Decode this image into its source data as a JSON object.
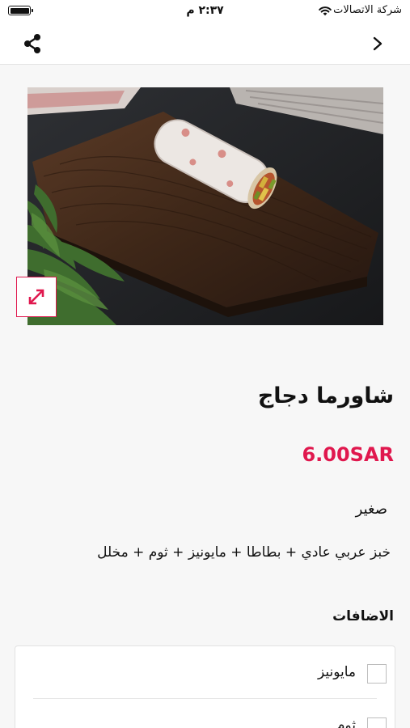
{
  "status_bar": {
    "carrier": "شركة الاتصالات",
    "time": "٢:٣٧ م"
  },
  "nav": {
    "share_icon": "share-icon",
    "back_icon": "chevron-right-icon"
  },
  "product": {
    "name": "شاورما دجاج",
    "price": "6.00SAR",
    "size": "صغير",
    "description": "خبز عربي عادي + بطاطا + مايونيز + ثوم + مخلل",
    "expand_icon": "expand-icon"
  },
  "addons": {
    "title": "الاضافات",
    "items": [
      {
        "label": "مايونيز",
        "checked": false
      },
      {
        "label": "ثوم",
        "checked": false
      }
    ]
  },
  "colors": {
    "accent": "#e0184e",
    "background": "#f7f7f7"
  }
}
